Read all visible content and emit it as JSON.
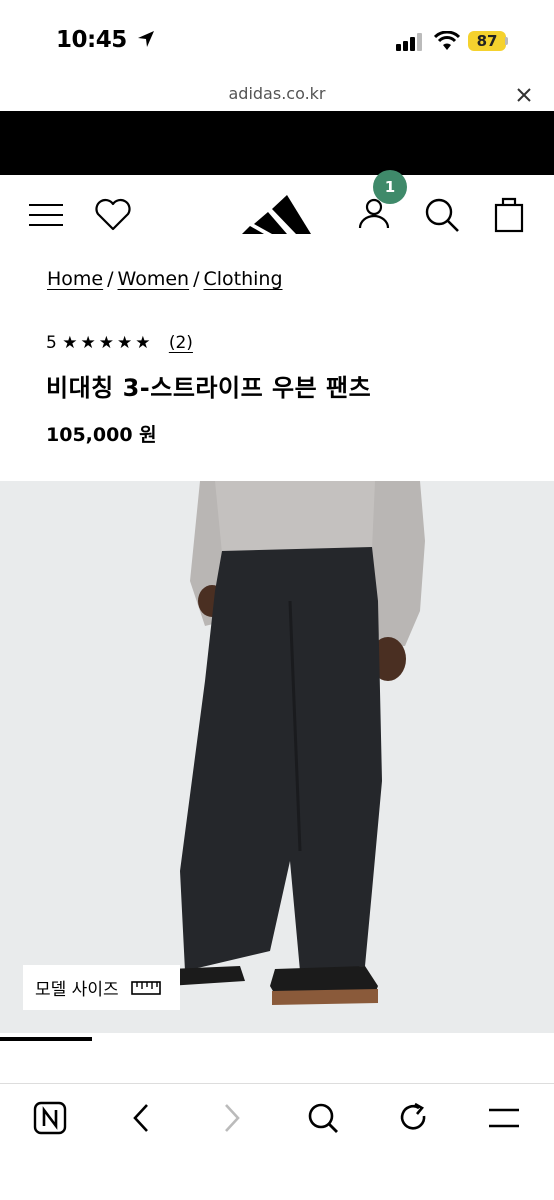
{
  "status_bar": {
    "time": "10:45",
    "battery": "87"
  },
  "browser": {
    "url": "adidas.co.kr"
  },
  "header": {
    "cart_count": "1"
  },
  "breadcrumb": {
    "items": [
      "Home",
      "Women",
      "Clothing"
    ],
    "separator": "/"
  },
  "product": {
    "rating_value": "5",
    "stars": "★★★★★",
    "review_count": "(2)",
    "title": "비대칭 3-스트라이프 우븐 팬츠",
    "price": "105,000 원",
    "model_size_label": "모델 사이즈"
  },
  "colors": {
    "badge_green": "#3f8a6a",
    "battery_yellow": "#f5d22e",
    "image_bg": "#e9ebec"
  },
  "icons": [
    "location-arrow-icon",
    "signal-icon",
    "wifi-icon",
    "close-icon",
    "menu-icon",
    "heart-icon",
    "adidas-logo",
    "account-icon",
    "search-icon",
    "bag-icon",
    "ruler-icon",
    "naver-icon",
    "back-icon",
    "forward-icon",
    "toolbar-search-icon",
    "refresh-icon",
    "toolbar-menu-icon"
  ]
}
